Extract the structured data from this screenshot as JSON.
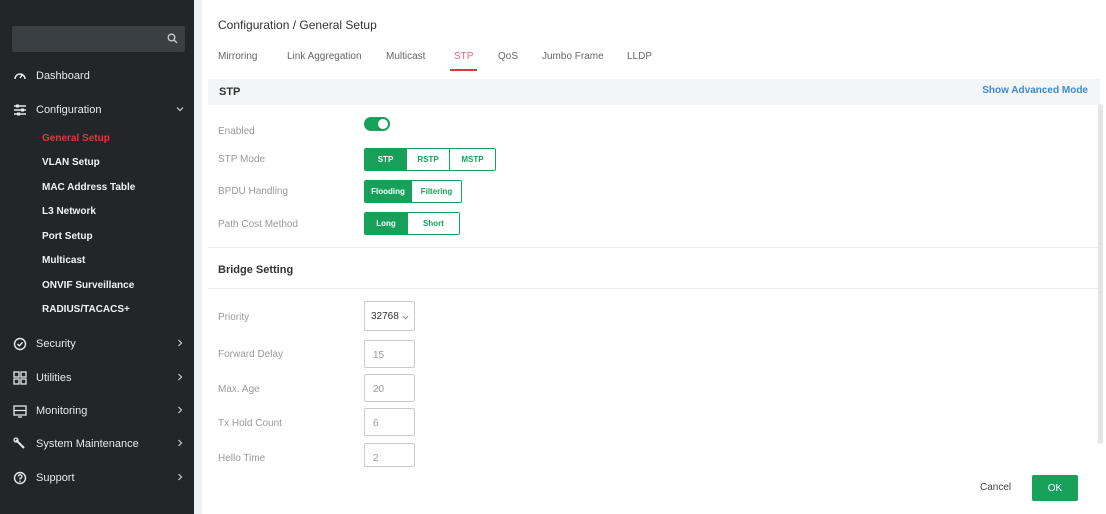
{
  "sidebar": {
    "search": {
      "placeholder": ""
    },
    "items": [
      {
        "label": "Dashboard",
        "icon": "dashboard-icon"
      },
      {
        "label": "Configuration",
        "icon": "configuration-icon"
      },
      {
        "label": "Security",
        "icon": "security-icon"
      },
      {
        "label": "Utilities",
        "icon": "utilities-icon"
      },
      {
        "label": "Monitoring",
        "icon": "monitoring-icon"
      },
      {
        "label": "System Maintenance",
        "icon": "wrench-icon"
      },
      {
        "label": "Support",
        "icon": "support-icon"
      }
    ],
    "subitems": [
      {
        "label": "General Setup",
        "active": true
      },
      {
        "label": "VLAN Setup"
      },
      {
        "label": "MAC Address Table"
      },
      {
        "label": "L3 Network"
      },
      {
        "label": "Port Setup"
      },
      {
        "label": "Multicast"
      },
      {
        "label": "ONVIF Surveillance"
      },
      {
        "label": "RADIUS/TACACS+"
      }
    ]
  },
  "header": {
    "breadcrumb": "Configuration / General Setup"
  },
  "tabs": [
    {
      "label": "Mirroring"
    },
    {
      "label": "Link Aggregation"
    },
    {
      "label": "Multicast"
    },
    {
      "label": "STP",
      "active": true
    },
    {
      "label": "QoS"
    },
    {
      "label": "Jumbo Frame"
    },
    {
      "label": "LLDP"
    }
  ],
  "section": {
    "title": "STP",
    "advanced_link": "Show Advanced Mode"
  },
  "fields": {
    "enabled": {
      "label": "Enabled",
      "value": true
    },
    "stp_mode": {
      "label": "STP Mode",
      "options": [
        "STP",
        "RSTP",
        "MSTP"
      ],
      "selected": "STP"
    },
    "bpdu": {
      "label": "BPDU Handling",
      "options": [
        "Flooding",
        "Filtering"
      ],
      "selected": "Flooding"
    },
    "path_cost": {
      "label": "Path Cost Method",
      "options": [
        "Long",
        "Short"
      ],
      "selected": "Long"
    }
  },
  "bridge": {
    "title": "Bridge Setting",
    "priority": {
      "label": "Priority",
      "value": "32768"
    },
    "forward_delay": {
      "label": "Forward Delay",
      "value": "15"
    },
    "max_age": {
      "label": "Max. Age",
      "value": "20"
    },
    "tx_hold": {
      "label": "Tx Hold Count",
      "value": "6"
    },
    "hello": {
      "label": "Hello Time",
      "value": "2"
    }
  },
  "footer": {
    "cancel": "Cancel",
    "ok": "OK"
  },
  "colors": {
    "accent": "#16a05a",
    "active_red": "#e0383e",
    "link": "#3b8ad9",
    "sidebar_bg": "#222629"
  }
}
